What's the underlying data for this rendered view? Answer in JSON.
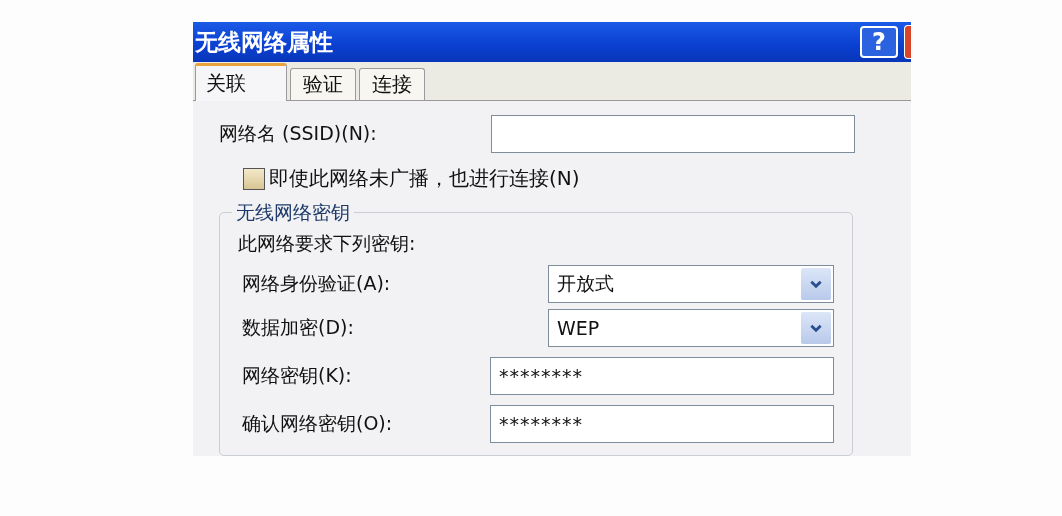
{
  "window": {
    "title": "无线网络属性",
    "help": "?"
  },
  "tabs": [
    {
      "label": "关联",
      "selected": true
    },
    {
      "label": "验证",
      "selected": false
    },
    {
      "label": "连接",
      "selected": false
    }
  ],
  "ssid": {
    "label": "网络名 (SSID)(N):"
  },
  "broadcast_checkbox": {
    "label": "即使此网络未广播，也进行连接(N)",
    "checked": false
  },
  "key_group": {
    "title": "无线网络密钥",
    "intro": "此网络要求下列密钥:",
    "rows": [
      {
        "kind": "select",
        "label": "网络身份验证(A):",
        "value": "开放式"
      },
      {
        "kind": "select",
        "label": "数据加密(D):",
        "value": "WEP"
      },
      {
        "kind": "password",
        "label": "网络密钥(K):",
        "value": "********"
      },
      {
        "kind": "password",
        "label": "确认网络密钥(O):",
        "value": "********"
      }
    ]
  }
}
